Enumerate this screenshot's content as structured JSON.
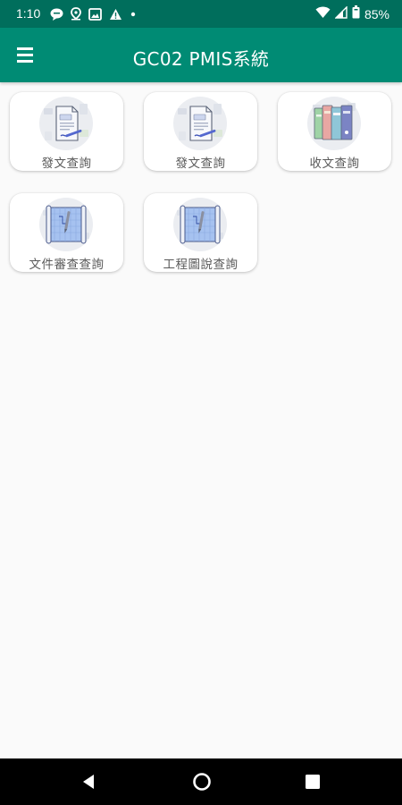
{
  "status_bar": {
    "time": "1:10",
    "battery": "85%",
    "icons": [
      "chat-icon",
      "location-pin-icon",
      "image-icon",
      "warning-icon",
      "dot-icon",
      "wifi-icon",
      "signal-icon",
      "battery-icon"
    ]
  },
  "app_bar": {
    "title": "GC02 PMIS系統",
    "menu_icon": "hamburger-menu-icon"
  },
  "grid": {
    "items": [
      {
        "label": "發文查詢",
        "icon": "document-icon"
      },
      {
        "label": "發文查詢",
        "icon": "document-icon"
      },
      {
        "label": "收文查詢",
        "icon": "binders-icon"
      },
      {
        "label": "文件審查查詢",
        "icon": "blueprint-icon"
      },
      {
        "label": "工程圖說查詢",
        "icon": "blueprint-icon"
      }
    ]
  },
  "nav_bar": {
    "icons": [
      "back-icon",
      "home-icon",
      "recents-icon"
    ]
  },
  "colors": {
    "status_bar": "#006e5c",
    "app_bar": "#008b74",
    "background": "#fafafa",
    "card": "#ffffff",
    "label_text": "#5a5a5a"
  }
}
